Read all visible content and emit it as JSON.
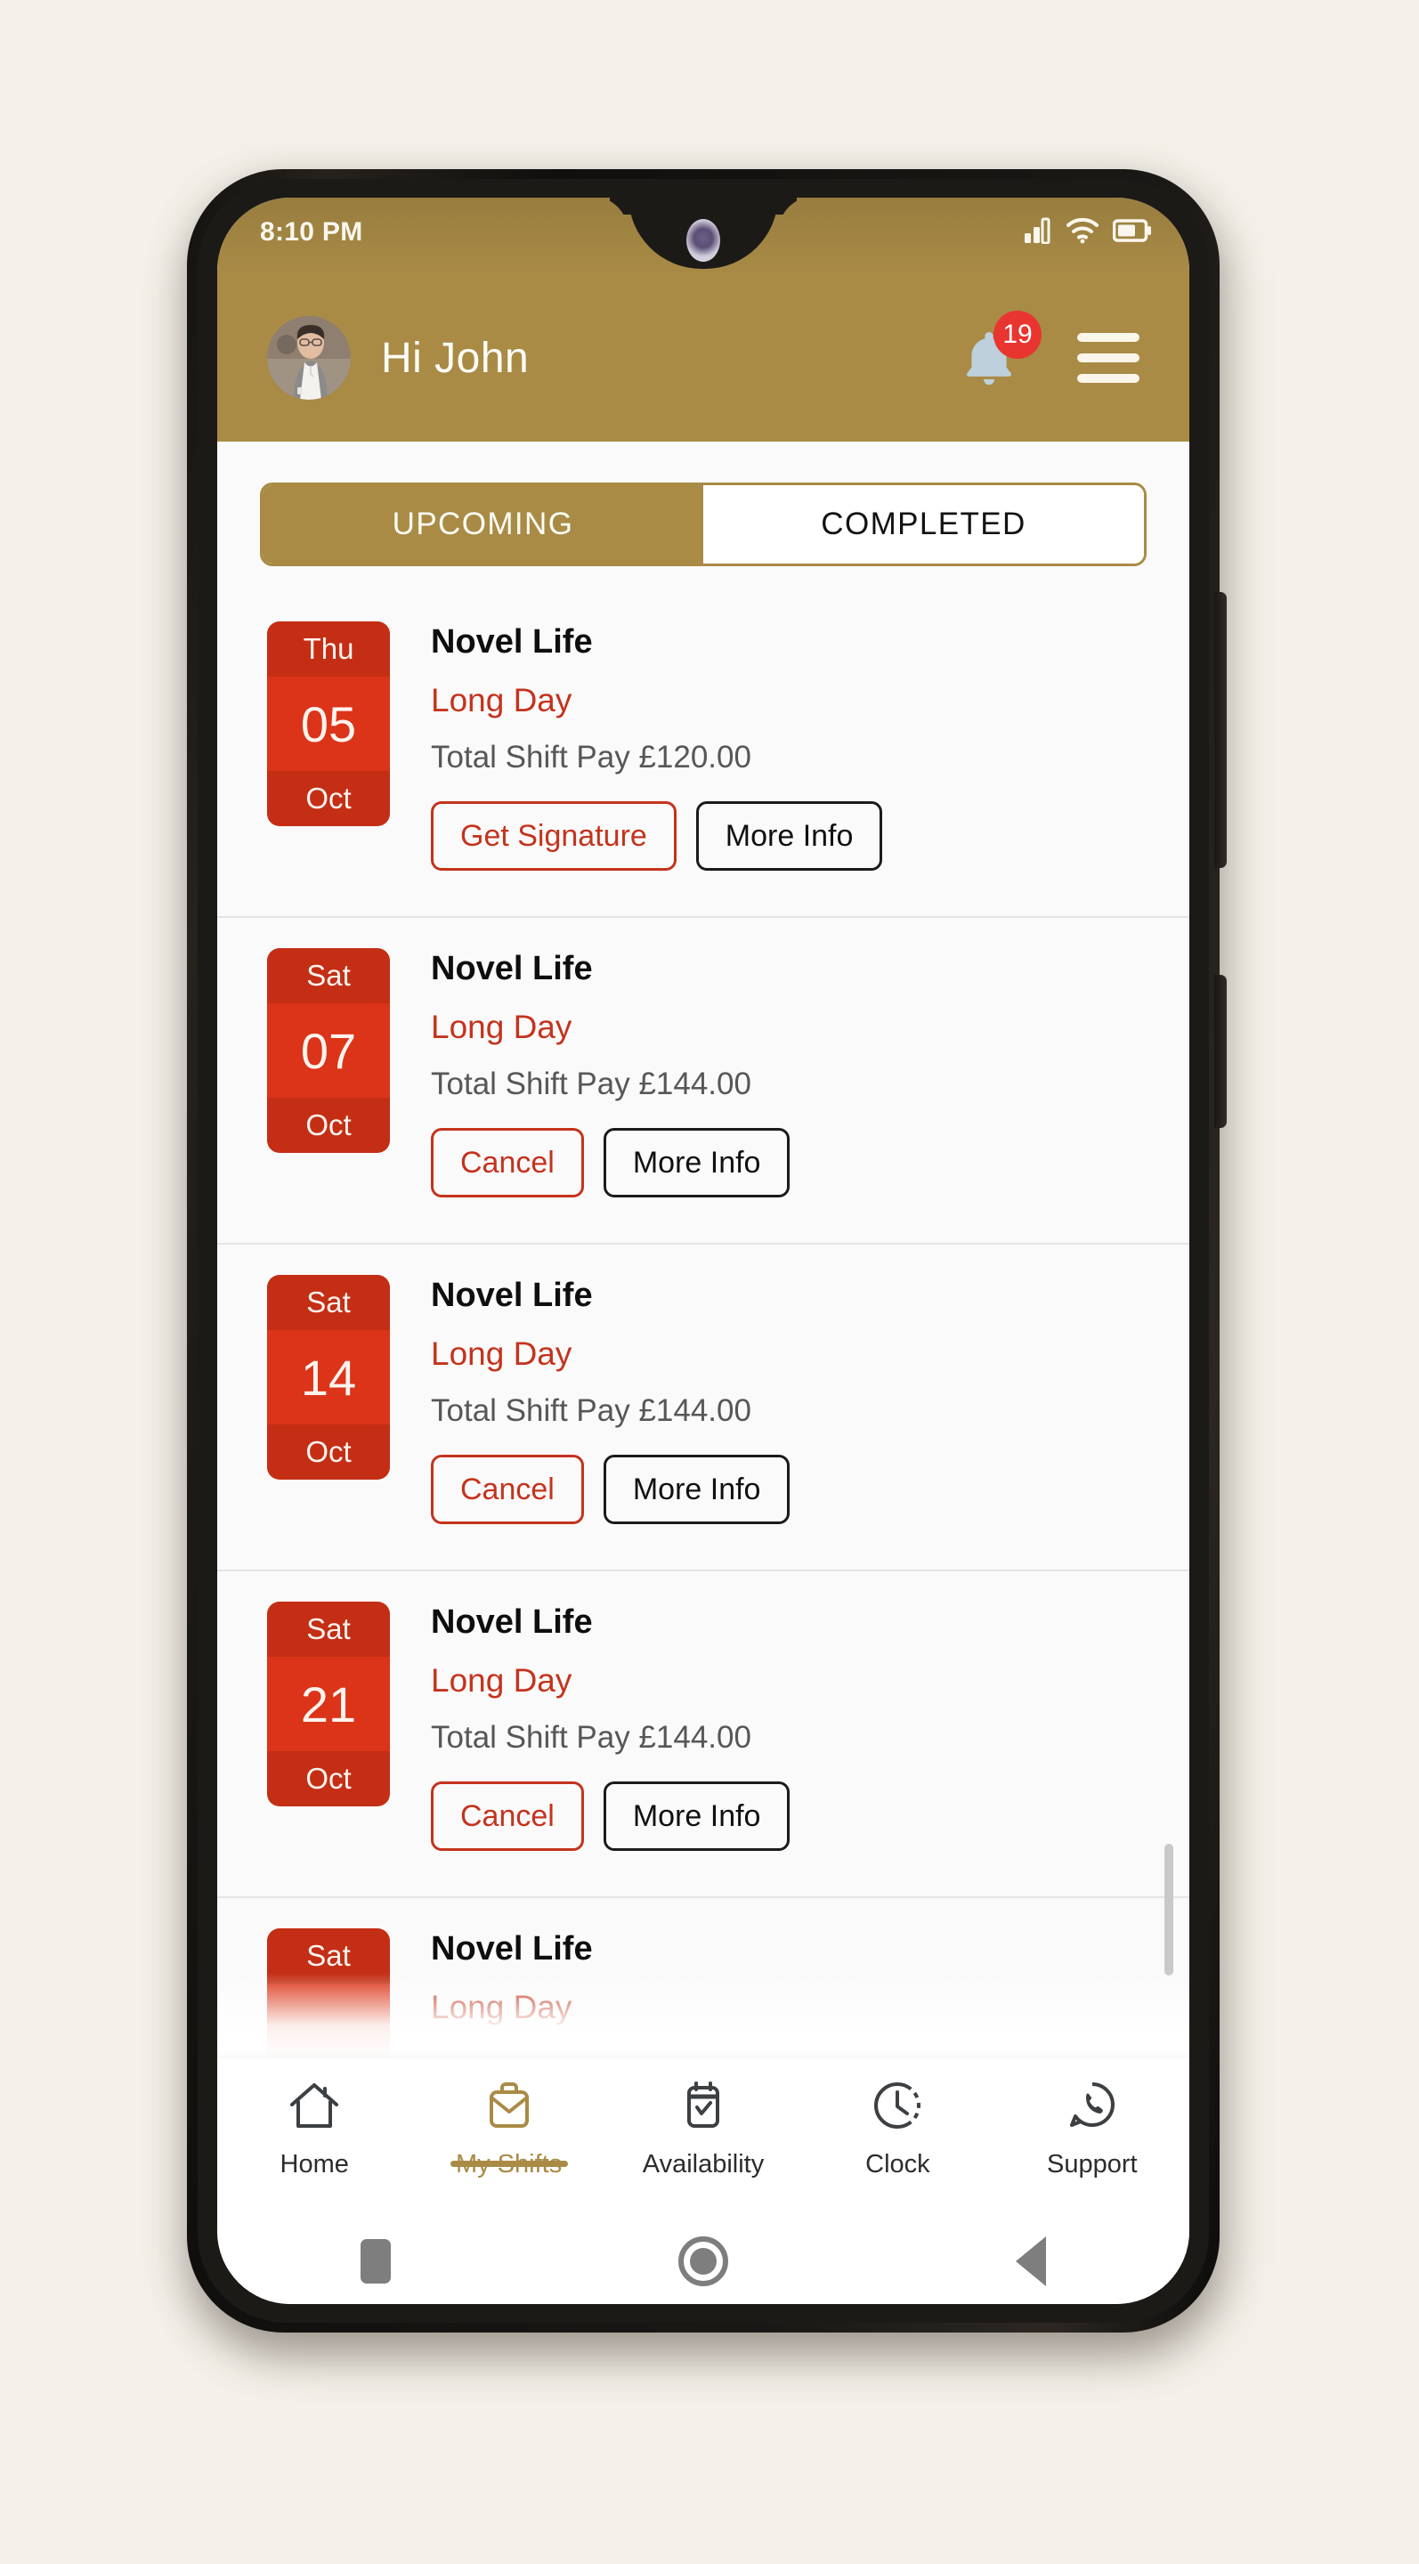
{
  "device": {
    "status_bar": {
      "time": "8:10 PM",
      "icons": [
        "signal-icon",
        "wifi-icon",
        "battery-icon"
      ]
    },
    "system_nav": {
      "recents_label": "recents-button",
      "home_label": "home-button",
      "back_label": "back-button"
    }
  },
  "header": {
    "greeting": "Hi John",
    "avatar_alt": "John profile photo",
    "notifications": {
      "icon": "bell-icon",
      "badge_count": "19"
    },
    "menu_icon": "hamburger-menu-icon"
  },
  "tabs": [
    {
      "label": "UPCOMING",
      "active": true
    },
    {
      "label": "COMPLETED",
      "active": false
    }
  ],
  "shifts": [
    {
      "day_of_week": "Thu",
      "day_number": "05",
      "month": "Oct",
      "client": "Novel Life",
      "shift_type": "Long Day",
      "pay": "Total Shift Pay £120.00",
      "primary_action": "Get Signature",
      "secondary_action": "More Info"
    },
    {
      "day_of_week": "Sat",
      "day_number": "07",
      "month": "Oct",
      "client": "Novel Life",
      "shift_type": "Long Day",
      "pay": "Total Shift Pay £144.00",
      "primary_action": "Cancel",
      "secondary_action": "More Info"
    },
    {
      "day_of_week": "Sat",
      "day_number": "14",
      "month": "Oct",
      "client": "Novel Life",
      "shift_type": "Long Day",
      "pay": "Total Shift Pay £144.00",
      "primary_action": "Cancel",
      "secondary_action": "More Info"
    },
    {
      "day_of_week": "Sat",
      "day_number": "21",
      "month": "Oct",
      "client": "Novel Life",
      "shift_type": "Long Day",
      "pay": "Total Shift Pay £144.00",
      "primary_action": "Cancel",
      "secondary_action": "More Info"
    },
    {
      "day_of_week": "Sat",
      "day_number": "",
      "month": "",
      "client": "Novel Life",
      "shift_type": "Long Day",
      "pay": "",
      "primary_action": "",
      "secondary_action": ""
    }
  ],
  "bottom_nav": [
    {
      "label": "Home",
      "icon": "home-icon",
      "active": false
    },
    {
      "label": "My Shifts",
      "icon": "briefcase-icon",
      "active": true
    },
    {
      "label": "Availability",
      "icon": "calendar-check-icon",
      "active": false
    },
    {
      "label": "Clock",
      "icon": "clock-icon",
      "active": false
    },
    {
      "label": "Support",
      "icon": "whatsapp-icon",
      "active": false
    }
  ],
  "colors": {
    "brand_gold": "#A98B46",
    "accent_red": "#DB3418",
    "text_red": "#C4331D",
    "badge_red": "#E8352F",
    "page_background": "#F4F1EA",
    "content_background": "#FAFAFA"
  }
}
